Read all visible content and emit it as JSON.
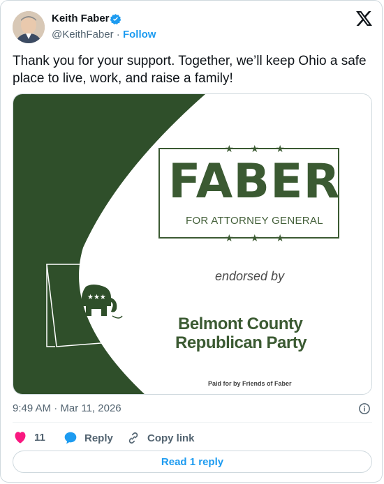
{
  "author": {
    "name": "Keith Faber",
    "handle": "@KeithFaber",
    "separator": "·",
    "follow_label": "Follow"
  },
  "tweet": {
    "text": "Thank you for your support. Together, we’ll keep Ohio a safe place to live, work, and raise a family!",
    "timestamp": "9:49 AM · Mar 11, 2026"
  },
  "media": {
    "headline": "FABER",
    "subheadline": "FOR ATTORNEY GENERAL",
    "stars": "★ ★ ★",
    "endorsed_text": "endorsed by",
    "party_line1": "Belmont County",
    "party_line2": "Republican Party",
    "disclaimer": "Paid for by Friends of Faber",
    "colors": {
      "green": "#2f4f2a",
      "text_green": "#3b5a32"
    }
  },
  "actions": {
    "likes_count": "11",
    "reply_label": "Reply",
    "copy_label": "Copy link",
    "read_replies_label": "Read 1 reply"
  },
  "colors": {
    "accent": "#1d9bf0",
    "like": "#f91880",
    "muted": "#536471"
  }
}
